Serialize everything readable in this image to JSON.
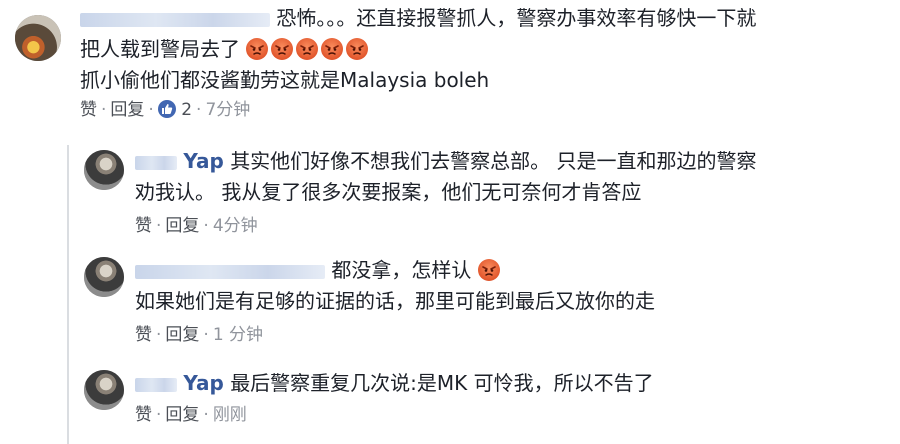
{
  "comments": [
    {
      "name": "",
      "text_line1": "恐怖。。。还直接报警抓人，警察办事效率有够快一下就",
      "text_line2_prefix": "把人载到警局去了",
      "text_line3": "抓小偷他们都没酱勤劳这就是Malaysia boleh",
      "reaction_icons": [
        "angry-face-icon",
        "angry-face-icon",
        "angry-face-icon",
        "angry-face-icon",
        "angry-face-icon"
      ],
      "like_label": "赞",
      "reply_label": "回复",
      "like_count": "2",
      "time": "7分钟"
    },
    {
      "name": "Yap",
      "text_line1": "其实他们好像不想我们去警察总部。 只是一直和那边的警察",
      "text_line2": "劝我认。 我从复了很多次要报案，他们无可奈何才肯答应",
      "like_label": "赞",
      "reply_label": "回复",
      "time": "4分钟"
    },
    {
      "name": "",
      "text_line1": "都没拿，怎样认",
      "text_line2": "如果她们是有足够的证据的话，那里可能到最后又放你的走",
      "like_label": "赞",
      "reply_label": "回复",
      "time": "1 分钟"
    },
    {
      "name": "Yap",
      "text_line1": "最后警察重复几次说:是MK 可怜我，所以不告了",
      "like_label": "赞",
      "reply_label": "回复",
      "time": "刚刚"
    }
  ],
  "separators": {
    "dot": "·"
  },
  "colors": {
    "link": "#365899",
    "meta": "#90949c",
    "like_blue": "#4267b2",
    "angry": "#e2572d"
  }
}
